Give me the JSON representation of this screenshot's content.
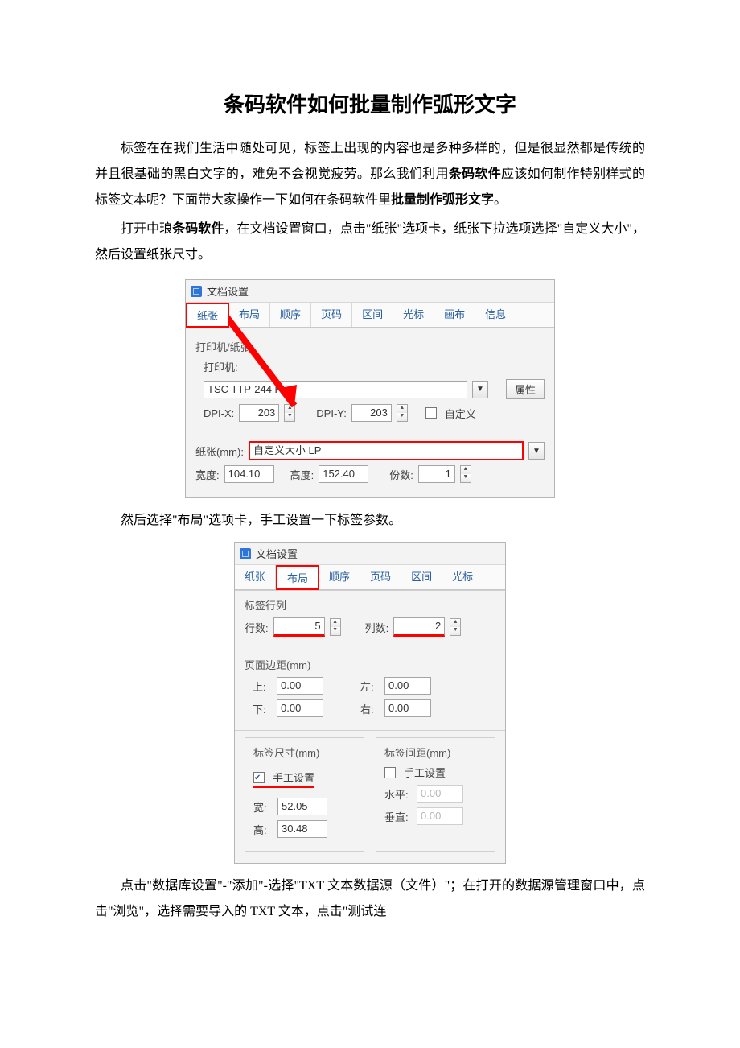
{
  "title": "条码软件如何批量制作弧形文字",
  "para1": {
    "t1": "标签在在我们生活中随处可见，标签上出现的内容也是多种多样的，但是很显然都是传统的并且很基础的黑白文字的，难免不会视觉疲劳。那么我们利用",
    "b1": "条码软件",
    "t2": "应该如何制作特别样式的标签文本呢？下面带大家操作一下如何在条码软件里",
    "b2": "批量制作弧形文字",
    "t3": "。"
  },
  "para2": {
    "t1": "打开中琅",
    "b1": "条码软件",
    "t2": "，在文档设置窗口，点击\"纸张\"选项卡，纸张下拉选项选择\"自定义大小\"，然后设置纸张尺寸。"
  },
  "dlg1": {
    "title": "文档设置",
    "tabs": [
      "纸张",
      "布局",
      "顺序",
      "页码",
      "区间",
      "光标",
      "画布",
      "信息"
    ],
    "section_printer": "打印机/纸张",
    "label_printer": "打印机:",
    "printer_value": "TSC TTP-244 Pro",
    "btn_properties": "属性",
    "dpix_label": "DPI-X:",
    "dpix_value": "203",
    "dpiy_label": "DPI-Y:",
    "dpiy_value": "203",
    "chk_custom": "自定义",
    "paper_label": "纸张(mm):",
    "paper_value": "自定义大小 LP",
    "width_label": "宽度:",
    "width_value": "104.10",
    "height_label": "高度:",
    "height_value": "152.40",
    "copies_label": "份数:",
    "copies_value": "1"
  },
  "para3": "然后选择\"布局\"选项卡，手工设置一下标签参数。",
  "dlg2": {
    "title": "文档设置",
    "tabs": [
      "纸张",
      "布局",
      "顺序",
      "页码",
      "区间",
      "光标"
    ],
    "section_rowscols": "标签行列",
    "rows_label": "行数:",
    "rows_value": "5",
    "cols_label": "列数:",
    "cols_value": "2",
    "section_margin": "页面边距(mm)",
    "top_label": "上:",
    "top_value": "0.00",
    "left_label": "左:",
    "left_value": "0.00",
    "bottom_label": "下:",
    "bottom_value": "0.00",
    "right_label": "右:",
    "right_value": "0.00",
    "section_size": "标签尺寸(mm)",
    "chk_manual": "手工设置",
    "w_label": "宽:",
    "w_value": "52.05",
    "h_label": "高:",
    "h_value": "30.48",
    "section_gap": "标签间距(mm)",
    "chk_manual2": "手工设置",
    "hgap_label": "水平:",
    "hgap_value": "0.00",
    "vgap_label": "垂直:",
    "vgap_value": "0.00"
  },
  "para4": "点击\"数据库设置\"-\"添加\"-选择\"TXT 文本数据源（文件）\"；在打开的数据源管理窗口中，点击\"浏览\"，选择需要导入的 TXT 文本，点击\"测试连"
}
